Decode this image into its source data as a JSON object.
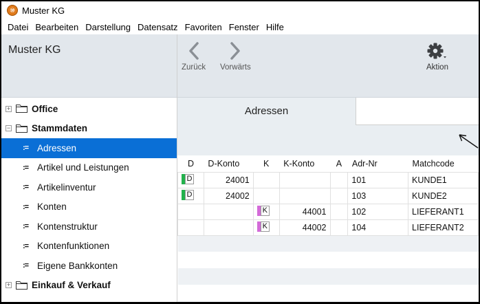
{
  "window": {
    "title": "Muster KG",
    "icon_letter": "⑩"
  },
  "menu": [
    "Datei",
    "Bearbeiten",
    "Darstellung",
    "Datensatz",
    "Favoriten",
    "Fenster",
    "Hilfe"
  ],
  "sidebar": {
    "company": "Muster KG",
    "groups": [
      {
        "label": "Office",
        "expanded": false,
        "expander": "+",
        "items": []
      },
      {
        "label": "Stammdaten",
        "expanded": true,
        "expander": "−",
        "items": [
          {
            "label": "Adressen",
            "selected": true
          },
          {
            "label": "Artikel und Leistungen"
          },
          {
            "label": "Artikelinventur"
          },
          {
            "label": "Konten"
          },
          {
            "label": "Kontenstruktur"
          },
          {
            "label": "Kontenfunktionen"
          },
          {
            "label": "Eigene Bankkonten"
          }
        ]
      },
      {
        "label": "Einkauf & Verkauf",
        "expanded": false,
        "expander": "+",
        "items": []
      }
    ],
    "list_icon": ":="
  },
  "toolbar": {
    "back_label": "Zurück",
    "forward_label": "Vorwärts",
    "action_label": "Aktion"
  },
  "tabs": {
    "active": "Adressen"
  },
  "table": {
    "columns": [
      "D",
      "D-Konto",
      "K",
      "K-Konto",
      "A",
      "Adr-Nr",
      "Matchcode"
    ],
    "rows": [
      {
        "d": "D",
        "d_konto": "24001",
        "k": "",
        "k_konto": "",
        "a": "",
        "adr_nr": "101",
        "matchcode": "KUNDE1"
      },
      {
        "d": "D",
        "d_konto": "24002",
        "k": "",
        "k_konto": "",
        "a": "",
        "adr_nr": "103",
        "matchcode": "KUNDE2"
      },
      {
        "d": "",
        "d_konto": "",
        "k": "K",
        "k_konto": "44001",
        "a": "",
        "adr_nr": "102",
        "matchcode": "LIEFERANT1"
      },
      {
        "d": "",
        "d_konto": "",
        "k": "K",
        "k_konto": "44002",
        "a": "",
        "adr_nr": "104",
        "matchcode": "LIEFERANT2"
      }
    ]
  },
  "colors": {
    "debitor": "#22b24c",
    "kreditor": "#d36bd8",
    "selection": "#0a6fd6"
  }
}
